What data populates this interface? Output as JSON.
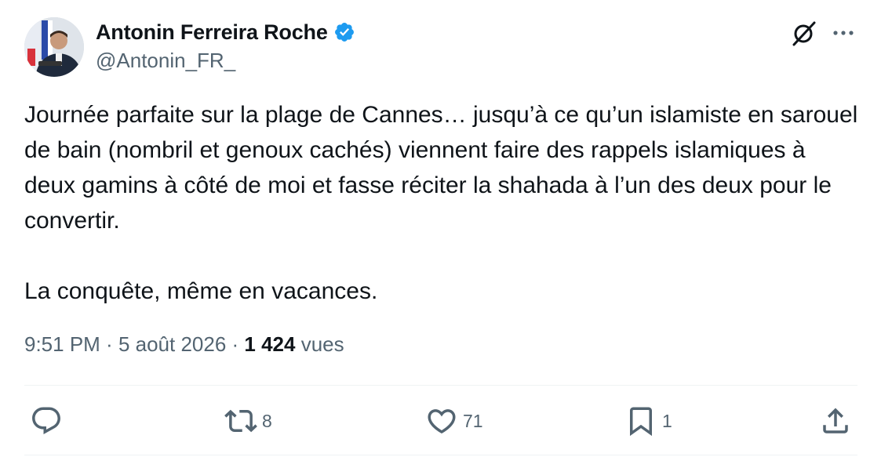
{
  "author": {
    "display_name": "Antonin Ferreira Roche",
    "handle": "@Antonin_FR_",
    "verified": true,
    "avatar_icon": "profile-photo"
  },
  "header_actions": {
    "grok_icon": "grok-icon",
    "more_icon": "more-dots-icon"
  },
  "tweet": {
    "paragraph_1": "Journée parfaite sur la plage de Cannes… jusqu’à ce qu’un islamiste en sarouel de bain (nombril et genoux cachés) viennent faire des rappels islamiques à deux gamins à côté de moi et fasse réciter la shahada à l’un des deux pour le convertir.",
    "paragraph_2": "La conquête, même en vacances."
  },
  "meta": {
    "time": "9:51 PM",
    "separator": " · ",
    "date": "5 août 2026",
    "views_count": "1 424",
    "views_label": "vues"
  },
  "actions": {
    "reply": {
      "icon": "reply-icon",
      "count": ""
    },
    "retweet": {
      "icon": "retweet-icon",
      "count": "8"
    },
    "like": {
      "icon": "heart-icon",
      "count": "71"
    },
    "bookmark": {
      "icon": "bookmark-icon",
      "count": "1"
    },
    "share": {
      "icon": "share-icon"
    }
  },
  "colors": {
    "text": "#0f1419",
    "secondary": "#536471",
    "verified": "#1d9bf0",
    "divider": "#eff3f4"
  }
}
